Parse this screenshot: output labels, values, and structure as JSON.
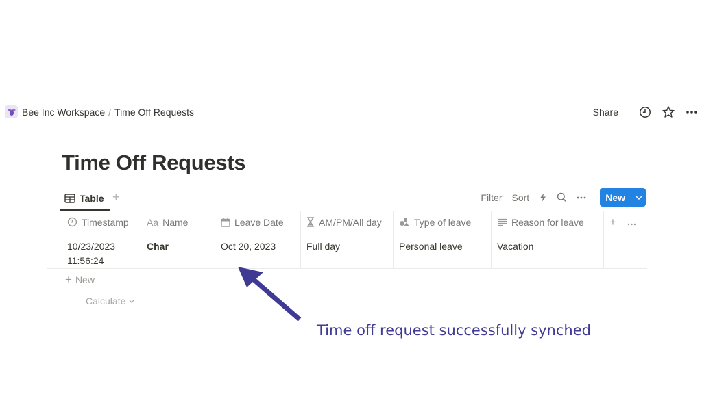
{
  "breadcrumb": {
    "workspace_icon": "bee-logo-icon",
    "workspace": "Bee Inc Workspace",
    "separator": "/",
    "page": "Time Off Requests"
  },
  "topbar": {
    "share_label": "Share",
    "icons": [
      "clock-history-icon",
      "star-icon",
      "more-horizontal-icon"
    ]
  },
  "page": {
    "title": "Time Off Requests"
  },
  "view": {
    "active_tab": "Table",
    "tab_icon": "table-icon",
    "add_view": "+",
    "filter_label": "Filter",
    "sort_label": "Sort",
    "new_label": "New"
  },
  "table": {
    "columns": [
      {
        "icon": "clock-icon",
        "label": "Timestamp"
      },
      {
        "icon": "text-aa-icon",
        "label": "Name",
        "icon_text": "Aa"
      },
      {
        "icon": "calendar-icon",
        "label": "Leave Date"
      },
      {
        "icon": "hourglass-icon",
        "label": "AM/PM/All day"
      },
      {
        "icon": "shapes-icon",
        "label": "Type of leave"
      },
      {
        "icon": "lines-icon",
        "label": "Reason for leave"
      }
    ],
    "rows": [
      {
        "timestamp_date": "10/23/2023",
        "timestamp_time": "11:56:24",
        "name": "Char",
        "leave_date": "Oct 20, 2023",
        "am_pm": "Full day",
        "type": "Personal leave",
        "reason": "Vacation"
      }
    ],
    "new_row_label": "New",
    "calculate_label": "Calculate"
  },
  "annotation": {
    "text": "Time off request successfully synched",
    "color": "#3f3a93"
  },
  "colors": {
    "accent": "#2383e2",
    "text": "#37352f",
    "muted": "#787774"
  }
}
